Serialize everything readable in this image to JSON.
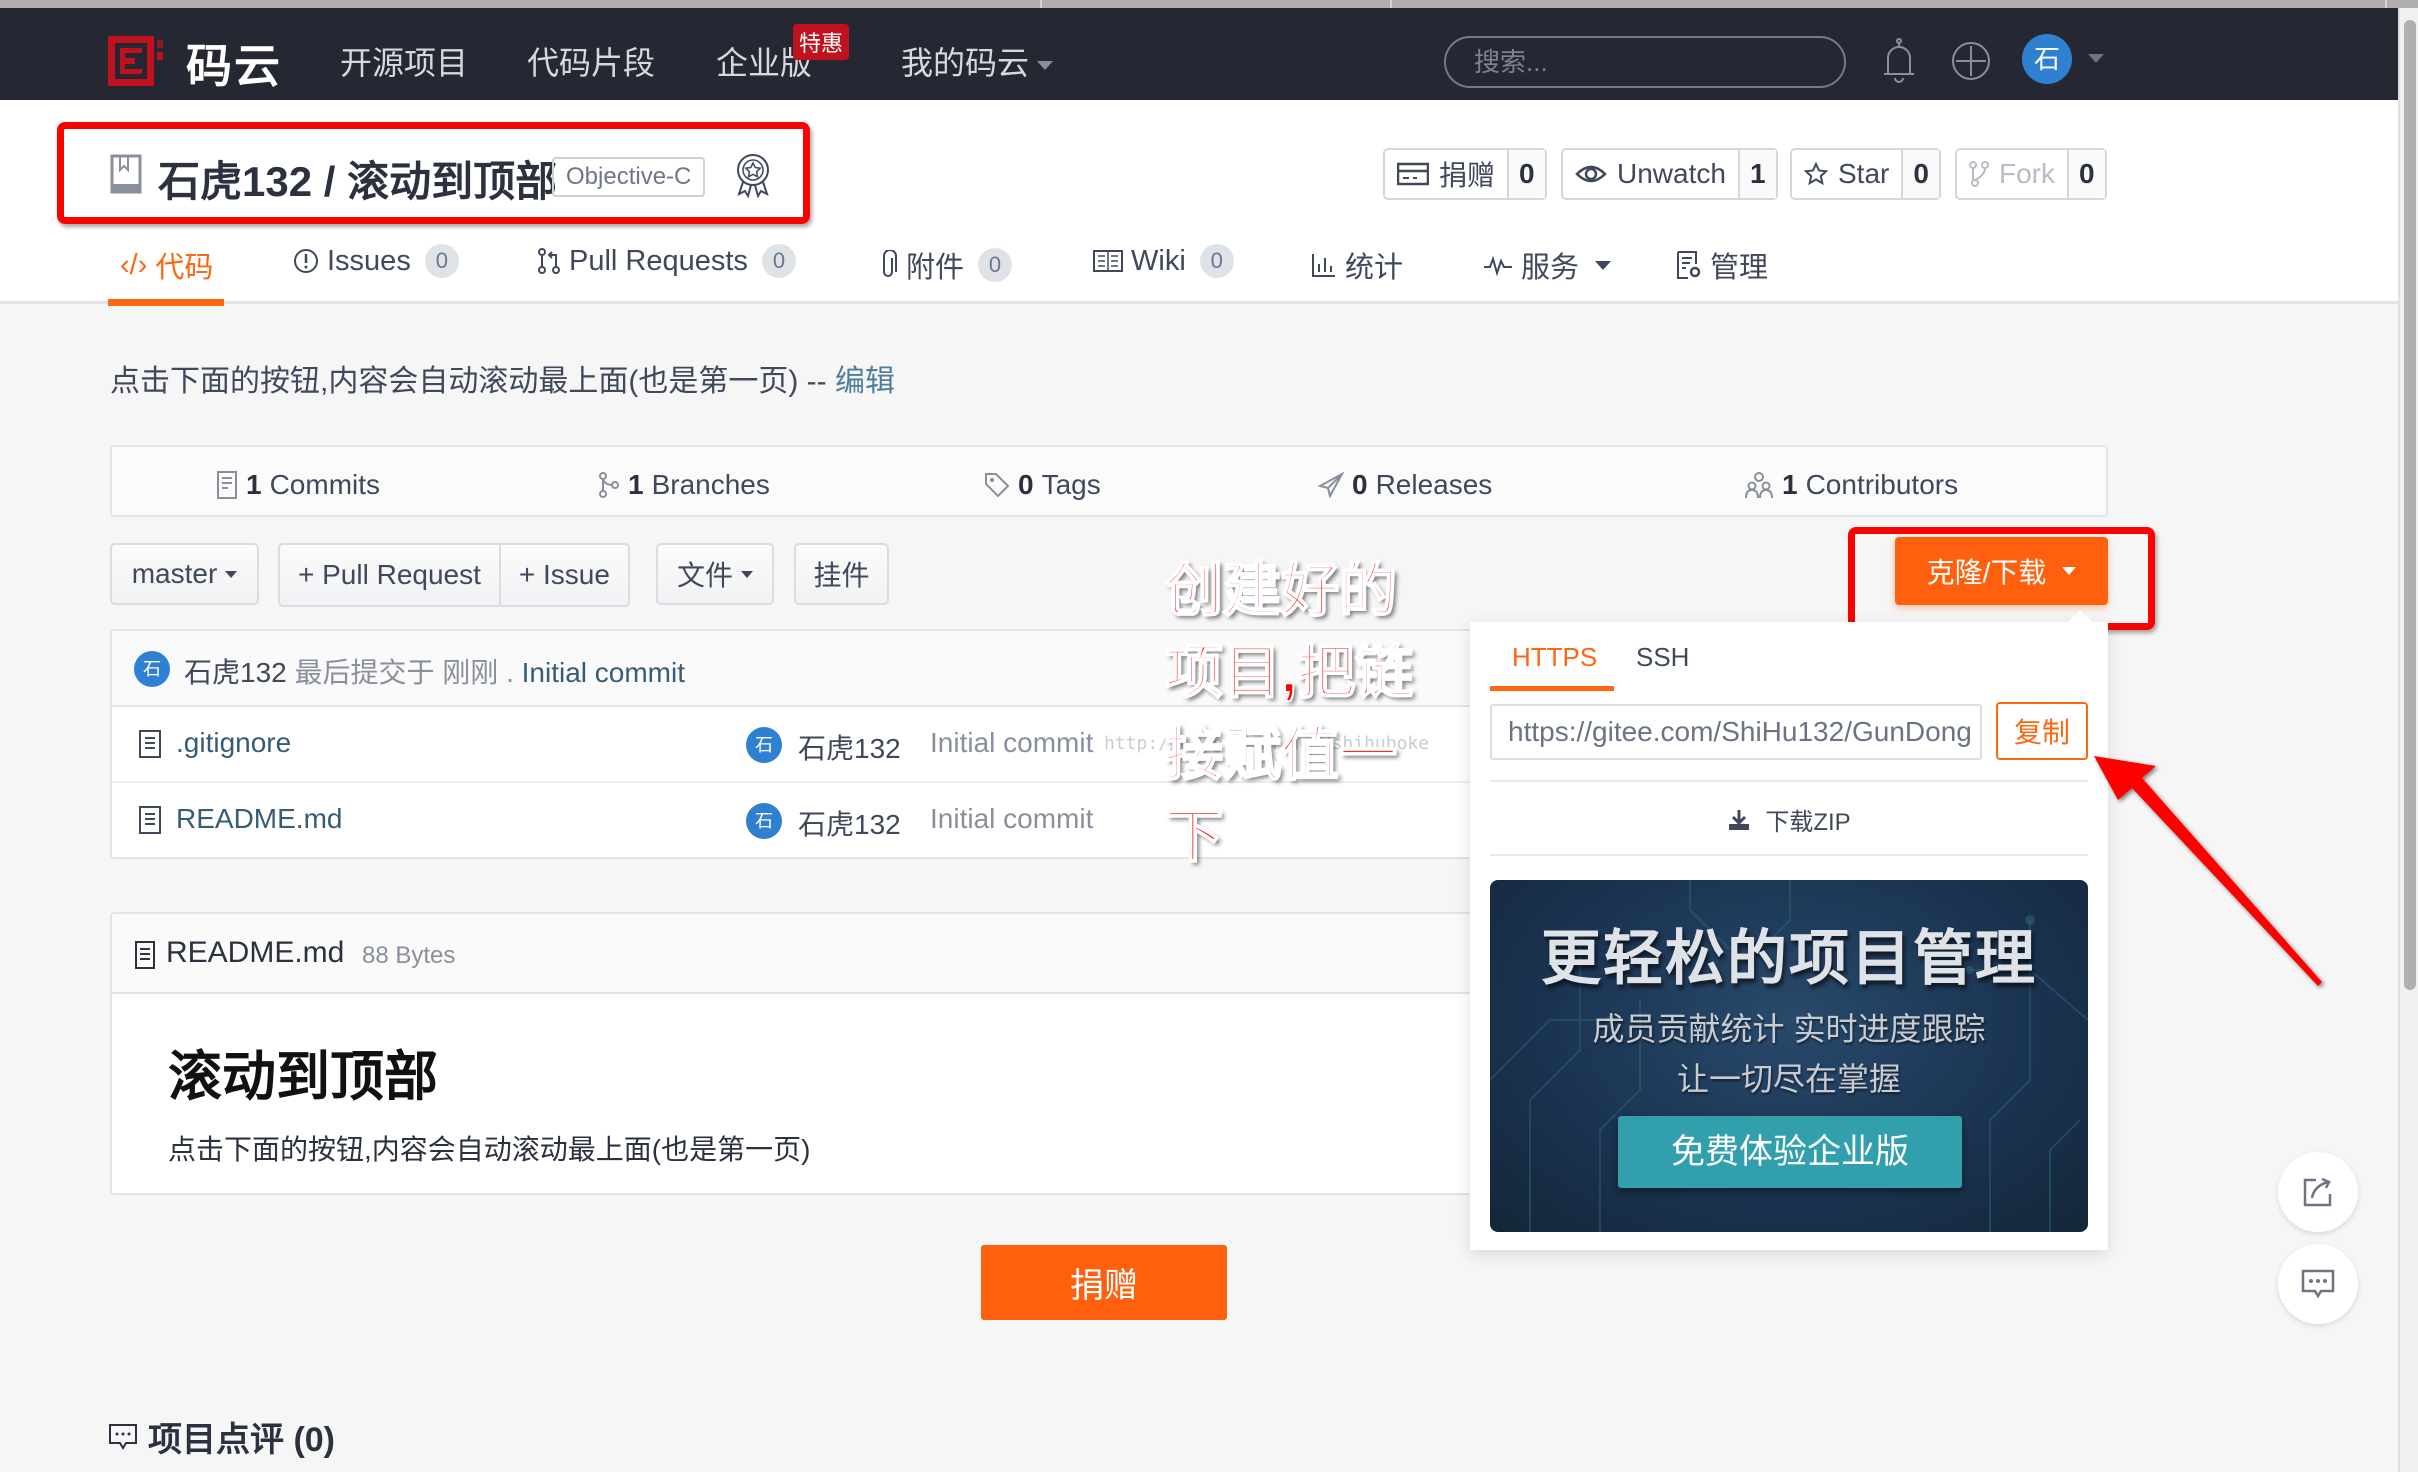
{
  "topnav": {
    "logo_text": "码云",
    "items": [
      {
        "label": "开源项目"
      },
      {
        "label": "代码片段"
      },
      {
        "label": "企业版",
        "badge": "特惠"
      },
      {
        "label": "我的码云"
      }
    ],
    "search_placeholder": "搜索...",
    "user_avatar_char": "石"
  },
  "repo": {
    "title": "石虎132 / 滚动到顶部",
    "language": "Objective-C",
    "actions": [
      {
        "label": "捐赠",
        "count": "0",
        "icon": "card-icon"
      },
      {
        "label": "Unwatch",
        "count": "1",
        "icon": "eye-icon"
      },
      {
        "label": "Star",
        "count": "0",
        "icon": "star-icon"
      },
      {
        "label": "Fork",
        "count": "0",
        "icon": "fork-icon",
        "disabled": true
      }
    ],
    "tabs": [
      {
        "label": "代码",
        "icon": "code-icon",
        "active": true
      },
      {
        "label": "Issues",
        "badge": "0",
        "icon": "issue-icon"
      },
      {
        "label": "Pull Requests",
        "badge": "0",
        "icon": "pull-request-icon"
      },
      {
        "label": "附件",
        "badge": "0",
        "icon": "paperclip-icon"
      },
      {
        "label": "Wiki",
        "badge": "0",
        "icon": "book-icon"
      },
      {
        "label": "统计",
        "icon": "chart-icon"
      },
      {
        "label": "服务",
        "icon": "pulse-icon",
        "dropdown": true
      },
      {
        "label": "管理",
        "icon": "settings-doc-icon"
      }
    ]
  },
  "description": {
    "text": "点击下面的按钮,内容会自动滚动最上面(也是第一页) -- ",
    "edit_link": "编辑"
  },
  "stats": [
    {
      "count": "1",
      "label": "Commits",
      "icon": "commits-icon"
    },
    {
      "count": "1",
      "label": "Branches",
      "icon": "branch-icon"
    },
    {
      "count": "0",
      "label": "Tags",
      "icon": "tag-icon"
    },
    {
      "count": "0",
      "label": "Releases",
      "icon": "release-icon"
    },
    {
      "count": "1",
      "label": "Contributors",
      "icon": "contributors-icon"
    }
  ],
  "toolbar": {
    "branch": "master",
    "pull_request": "+ Pull Request",
    "issue": "+ Issue",
    "files": "文件",
    "widgets": "挂件",
    "clone": "克隆/下载"
  },
  "last_commit": {
    "avatar_char": "石",
    "author": "石虎132",
    "meta": "最后提交于 刚刚",
    "separator": ".",
    "message": "Initial commit"
  },
  "files": [
    {
      "name": ".gitignore",
      "author": "石虎132",
      "avatar_char": "石",
      "message": "Initial commit"
    },
    {
      "name": "README.md",
      "author": "石虎132",
      "avatar_char": "石",
      "message": "Initial commit"
    }
  ],
  "watermark": "http://blog.csdn.net/shihuboke",
  "clone_panel": {
    "tabs": [
      {
        "label": "HTTPS",
        "active": true
      },
      {
        "label": "SSH"
      }
    ],
    "url": "https://gitee.com/ShiHu132/GunDong",
    "copy_label": "复制",
    "download_zip": "下载ZIP",
    "ad": {
      "title": "更轻松的项目管理",
      "line1": "成员贡献统计   实时进度跟踪",
      "line2": "让一切尽在掌握",
      "cta": "免费体验企业版"
    }
  },
  "readme": {
    "filename": "README.md",
    "size": "88 Bytes",
    "heading": "滚动到顶部",
    "body": "点击下面的按钮,内容会自动滚动最上面(也是第一页)"
  },
  "donate_label": "捐赠",
  "comments": {
    "label": "项目点评 (0)"
  },
  "annotation": {
    "lines": [
      "创建好的",
      "项目,把链",
      "接赋值一",
      "下"
    ],
    "color": "#ff0000"
  },
  "colors": {
    "accent": "#fe6611",
    "nav_bg": "#252833",
    "link": "#375c77",
    "avatar": "#2f80d1"
  }
}
